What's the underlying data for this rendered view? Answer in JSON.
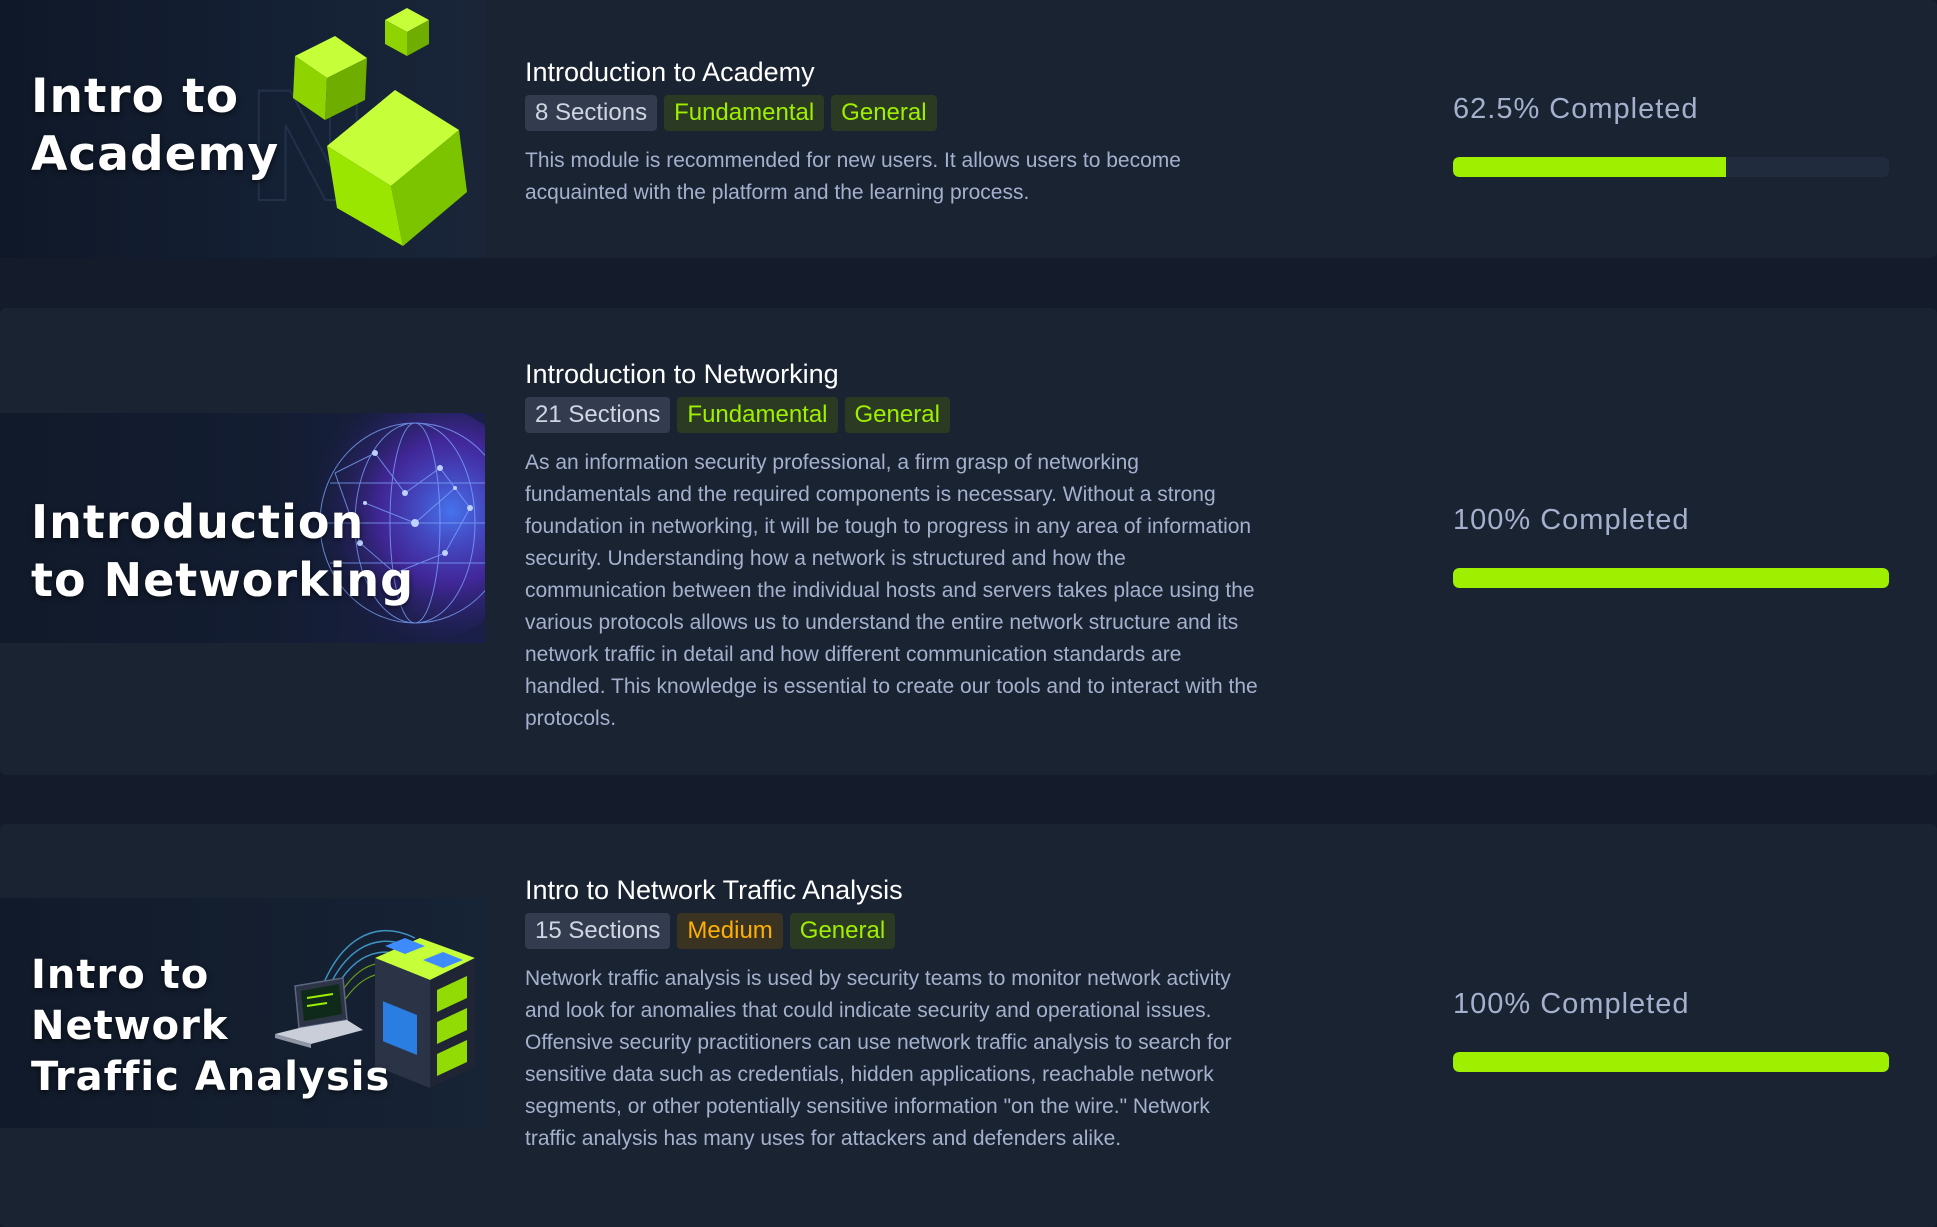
{
  "colors": {
    "background": "#141c2b",
    "card": "#1a2332",
    "accent_green": "#9fef00",
    "medium_orange": "#ffaf00",
    "muted_text": "#a4b1cd"
  },
  "modules": [
    {
      "thumbnail_title": "Intro to\nAcademy",
      "thumbnail_art": "green-cubes",
      "title": "Introduction to Academy",
      "sections": "8 Sections",
      "difficulty": "Fundamental",
      "category": "General",
      "description": "This module is recommended for new users. It allows users to become acquainted with the platform and the learning process.",
      "progress_label": "62.5% Completed",
      "progress_fraction": 0.625
    },
    {
      "thumbnail_title": "Introduction\nto Networking",
      "thumbnail_art": "network-globe",
      "title": "Introduction to Networking",
      "sections": "21 Sections",
      "difficulty": "Fundamental",
      "category": "General",
      "description": "As an information security professional, a firm grasp of networking fundamentals and the required components is necessary. Without a strong foundation in networking, it will be tough to progress in any area of information security. Understanding how a network is structured and how the communication between the individual hosts and servers takes place using the various protocols allows us to understand the entire network structure and its network traffic in detail and how different communication standards are handled. This knowledge is essential to create our tools and to interact with the protocols.",
      "progress_label": "100% Completed",
      "progress_fraction": 1.0
    },
    {
      "thumbnail_title": "Intro to\nNetwork\nTraffic Analysis",
      "thumbnail_art": "laptop-servers",
      "title": "Intro to Network Traffic Analysis",
      "sections": "15 Sections",
      "difficulty": "Medium",
      "category": "General",
      "description": "Network traffic analysis is used by security teams to monitor network activity and look for anomalies that could indicate security and operational issues. Offensive security practitioners can use network traffic analysis to search for sensitive data such as credentials, hidden applications, reachable network segments, or other potentially sensitive information \"on the wire.\" Network traffic analysis has many uses for attackers and defenders alike.",
      "progress_label": "100% Completed",
      "progress_fraction": 1.0
    }
  ]
}
